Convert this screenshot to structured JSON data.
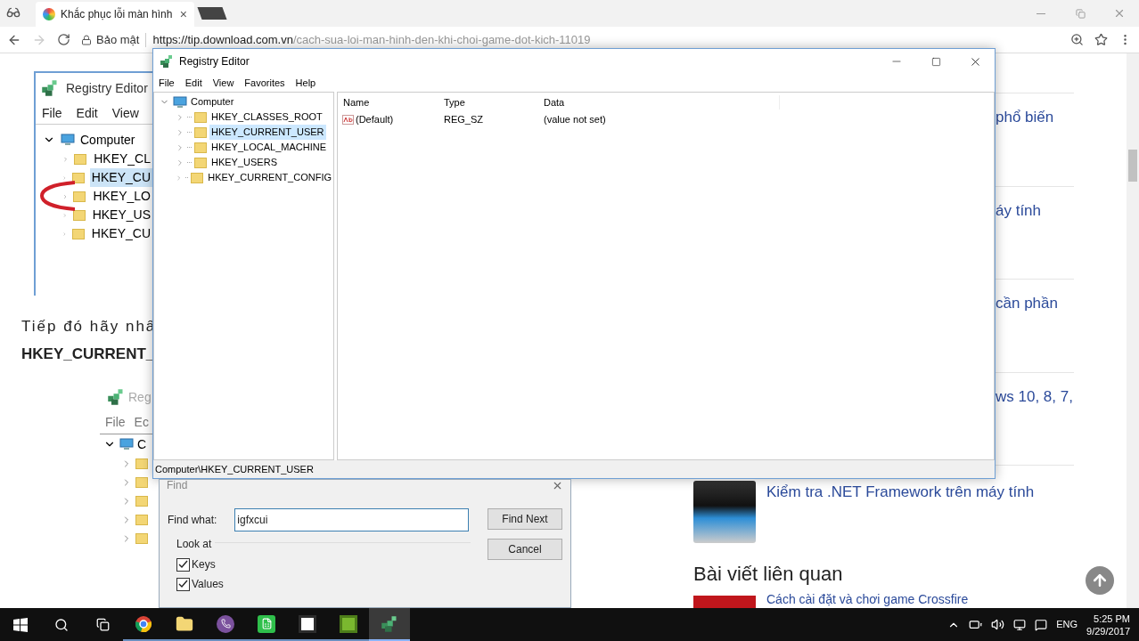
{
  "browser": {
    "tab": {
      "title": "Khắc phục lỗi màn hình",
      "close": "×"
    },
    "security": "Bảo mật",
    "url_host": "https://tip.download.com.vn",
    "url_path": "/cach-sua-loi-man-hinh-den-khi-choi-game-dot-kich-11019"
  },
  "article": {
    "figure_1": {
      "title": "Registry Editor",
      "menu": [
        "File",
        "Edit",
        "View"
      ],
      "root": {
        "label": "Computer",
        "expanded": true
      },
      "items": [
        {
          "label": "HKEY_CL",
          "selected": false
        },
        {
          "label": "HKEY_CU",
          "selected": true
        },
        {
          "label": "HKEY_LO",
          "selected": false
        },
        {
          "label": "HKEY_US",
          "selected": false
        },
        {
          "label": "HKEY_CU",
          "selected": false
        }
      ]
    },
    "paragraph": "Tiếp đó hãy nhấ",
    "bold_line": "HKEY_CURRENT_",
    "figure_2": {
      "title": "Reg",
      "menu": [
        "File",
        "Ec"
      ],
      "root": {
        "label": "C",
        "expanded": true
      },
      "items": [
        {
          "expanded": false
        },
        {
          "expanded": false
        },
        {
          "expanded": false
        },
        {
          "expanded": false
        },
        {
          "expanded": false
        }
      ]
    }
  },
  "sidebar": {
    "cut_items": [
      "phổ biến",
      "áy tính",
      "cần phần",
      "ws 10, 8, 7,"
    ],
    "item": {
      "title": "Kiểm tra .NET Framework trên máy tính"
    },
    "heading": "Bài viết liên quan",
    "related": "Cách cài đặt và chơi game Crossfire"
  },
  "registry_window": {
    "title": "Registry Editor",
    "menu": [
      "File",
      "Edit",
      "View",
      "Favorites",
      "Help"
    ],
    "tree": {
      "label": "Computer",
      "expanded": true,
      "children": [
        {
          "label": "HKEY_CLASSES_ROOT",
          "selected": false,
          "expanded": false
        },
        {
          "label": "HKEY_CURRENT_USER",
          "selected": true,
          "expanded": false
        },
        {
          "label": "HKEY_LOCAL_MACHINE",
          "selected": false,
          "expanded": false
        },
        {
          "label": "HKEY_USERS",
          "selected": false,
          "expanded": false
        },
        {
          "label": "HKEY_CURRENT_CONFIG",
          "selected": false,
          "expanded": false
        }
      ]
    },
    "columns": [
      "Name",
      "Type",
      "Data"
    ],
    "rows": [
      {
        "name": "(Default)",
        "type": "REG_SZ",
        "data": "(value not set)"
      }
    ],
    "status_bar": "Computer\\HKEY_CURRENT_USER"
  },
  "find_dialog": {
    "title": "Find",
    "find_label": "Find what:",
    "find_value": "igfxcui",
    "find_next": "Find Next",
    "cancel": "Cancel",
    "group": "Look at",
    "options": [
      {
        "label": "Keys",
        "checked": true
      },
      {
        "label": "Values",
        "checked": true
      }
    ]
  },
  "taskbar": {
    "apps": [
      {
        "kind": "chrome",
        "active": false
      },
      {
        "kind": "folder",
        "active": false
      },
      {
        "kind": "viber",
        "active": false
      },
      {
        "kind": "sheet",
        "active": false
      },
      {
        "kind": "camtasia",
        "active": false
      },
      {
        "kind": "camtasia-green",
        "active": false
      },
      {
        "kind": "regedit",
        "active": true
      }
    ],
    "language": "ENG",
    "time": "5:25 PM",
    "date": "9/29/2017"
  }
}
